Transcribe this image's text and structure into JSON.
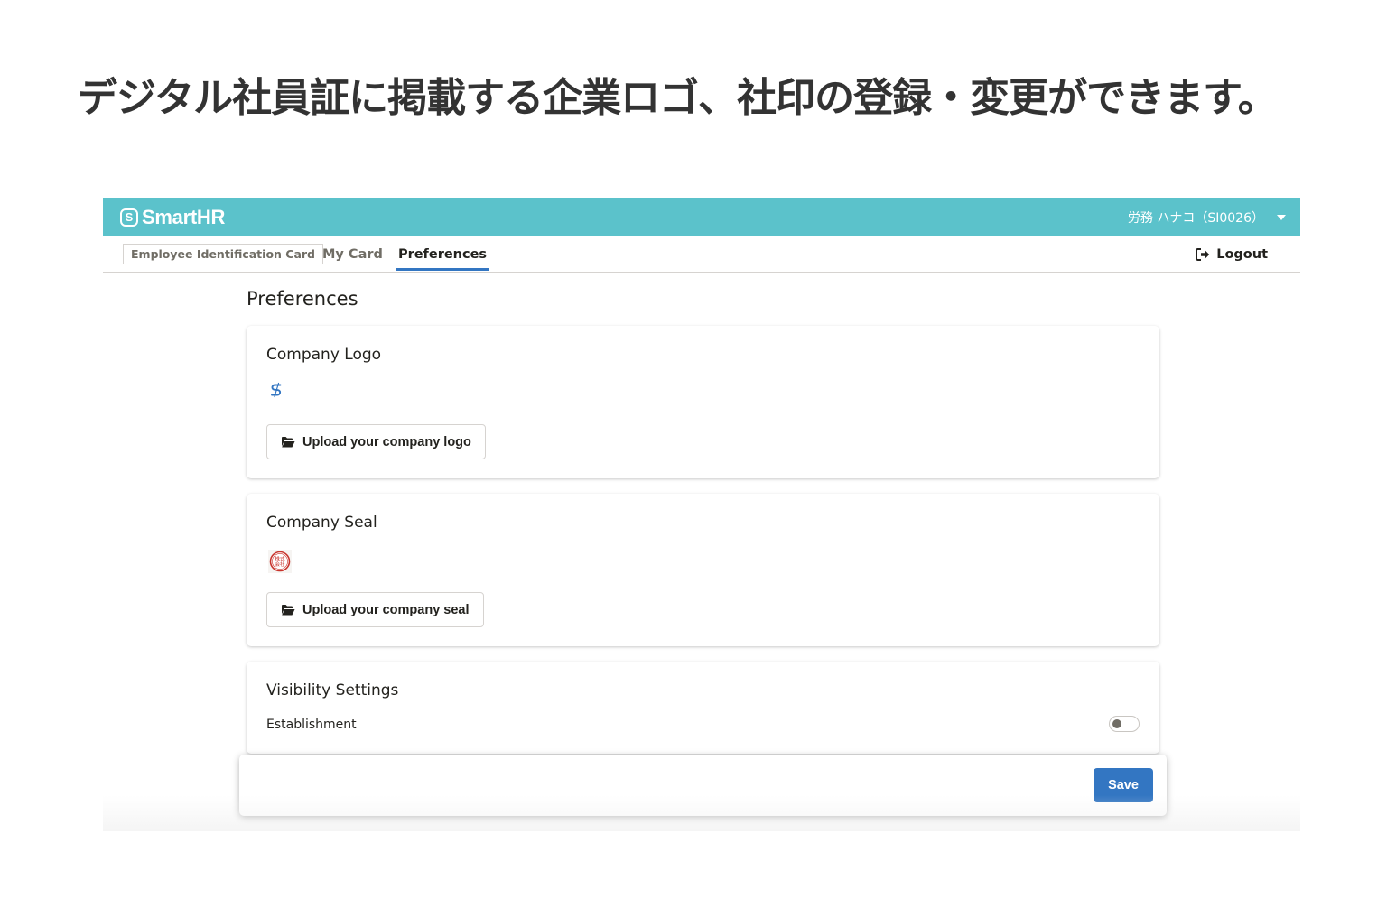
{
  "caption": "デジタル社員証に掲載する企業ロゴ、社印の登録・変更ができます。",
  "header": {
    "brand_name": "SmartHR",
    "user_label": "労務 ハナコ（SI0026）"
  },
  "tabs": {
    "card_label": "Employee Identification Card",
    "my_card": "My Card",
    "preferences": "Preferences",
    "logout": "Logout"
  },
  "page": {
    "title": "Preferences"
  },
  "company_logo": {
    "title": "Company Logo",
    "upload_label": "Upload your company logo"
  },
  "company_seal": {
    "title": "Company Seal",
    "upload_label": "Upload your company seal",
    "seal_text": "株式会社"
  },
  "visibility": {
    "title": "Visibility Settings",
    "establishment_label": "Establishment",
    "establishment_enabled": false
  },
  "footer": {
    "save_label": "Save"
  },
  "colors": {
    "header_bg": "#5bc2cb",
    "primary": "#3376c2",
    "seal_red": "#c8332b"
  }
}
